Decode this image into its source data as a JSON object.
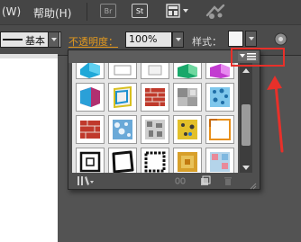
{
  "menubar": {
    "window_menu": "(W)",
    "help_menu": "帮助(H)",
    "bridge_button": "Br",
    "stock_button": "St"
  },
  "controlbar": {
    "stroke_profile": "基本",
    "opacity_label": "不透明度：",
    "opacity_value": "100%",
    "style_label": "样式："
  },
  "panel": {
    "name": "graphic-styles",
    "swatch_rows": 4,
    "swatch_columns": 5
  },
  "colors": {
    "menubar_bg": "#454545",
    "controlbar_bg": "#4b4b4b",
    "workspace_bg": "#535353",
    "opacity_label": "#e59a1e",
    "annotation_red": "#e8302a"
  },
  "annotation": {
    "highlight": "panel-menu-button",
    "arrow": "up"
  }
}
